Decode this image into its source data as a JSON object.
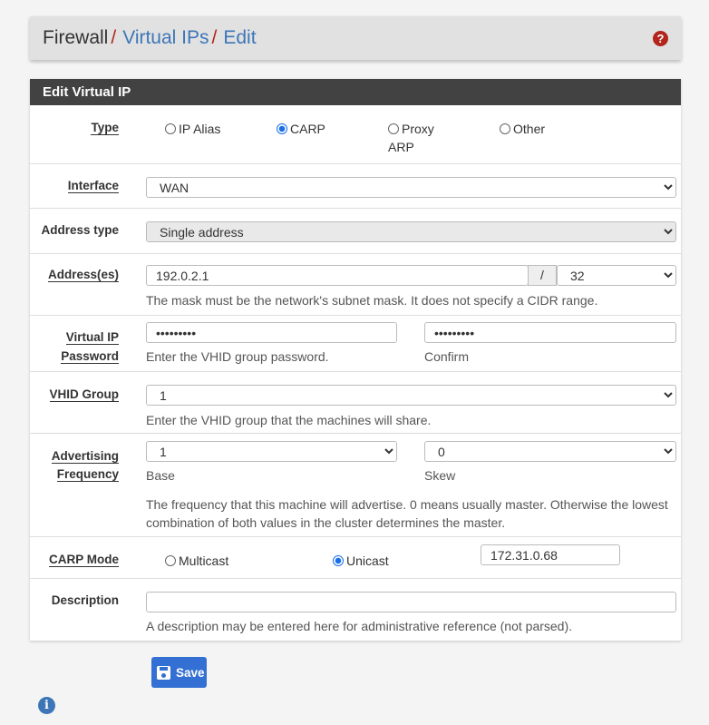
{
  "breadcrumb": {
    "root": "Firewall",
    "sep": "/",
    "section": "Virtual IPs",
    "page": "Edit"
  },
  "panel_title": "Edit Virtual IP",
  "type": {
    "label": "Type",
    "options": [
      "IP Alias",
      "CARP",
      "Proxy",
      "ARP",
      "Other"
    ],
    "selected": "CARP"
  },
  "interface": {
    "label": "Interface",
    "value": "WAN"
  },
  "address_type": {
    "label": "Address type",
    "value": "Single address"
  },
  "addresses": {
    "label": "Address(es)",
    "value": "192.0.2.1",
    "slash": "/",
    "mask": "32",
    "hint": "The mask must be the network's subnet mask. It does not specify a CIDR range."
  },
  "vip_password": {
    "label1": "Virtual IP",
    "label2": "Password",
    "value": "•••••••••",
    "confirm_value": "•••••••••",
    "hint": "Enter the VHID group password.",
    "confirm_hint": "Confirm"
  },
  "vhid": {
    "label": "VHID Group",
    "value": "1",
    "hint": "Enter the VHID group that the machines will share."
  },
  "adv_freq": {
    "label1": "Advertising",
    "label2": "Frequency",
    "base": "1",
    "skew": "0",
    "base_hint": "Base",
    "skew_hint": "Skew",
    "hint1": "The frequency that this machine will advertise. 0 means usually master. Otherwise the lowest",
    "hint2": "combination of both values in the cluster determines the master."
  },
  "carp_mode": {
    "label": "CARP Mode",
    "options": [
      "Multicast",
      "Unicast"
    ],
    "selected": "Unicast",
    "peer": "172.31.0.68"
  },
  "description": {
    "label": "Description",
    "value": "",
    "hint": "A description may be entered here for administrative reference (not parsed)."
  },
  "save_label": "Save",
  "colors": {
    "accent": "#3470d3",
    "header_bar": "#424242",
    "link": "#3c76b7",
    "help": "#b1251b"
  }
}
